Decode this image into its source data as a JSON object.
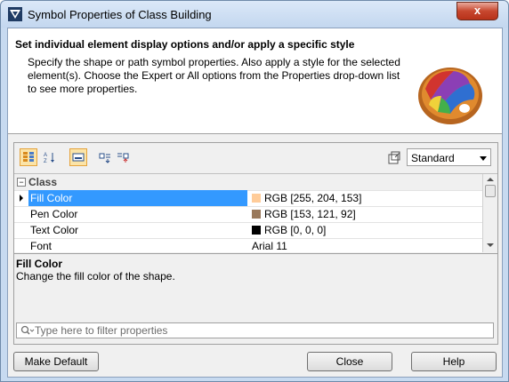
{
  "window": {
    "title": "Symbol Properties of Class Building",
    "close_label": "x"
  },
  "header": {
    "title": "Set individual element display options and/or apply a specific style",
    "description": "Specify the shape or path symbol properties. Also apply a style for the selected element(s). Choose the Expert or All options from the Properties drop-down list to see more properties."
  },
  "toolbar": {
    "icons": [
      "categorized-view-icon",
      "sort-alphabetical-icon",
      "show-description-icon",
      "expand-all-icon",
      "collapse-all-icon",
      "apply-style-icon"
    ],
    "mode_selected": "Standard"
  },
  "grid": {
    "group": {
      "label": "Class",
      "expander": "−"
    },
    "rows": [
      {
        "name": "Fill Color",
        "value": "RGB [255, 204, 153]",
        "swatch": "#ffcc99",
        "selected": true
      },
      {
        "name": "Pen Color",
        "value": "RGB [153, 121, 92]",
        "swatch": "#99795c",
        "selected": false
      },
      {
        "name": "Text Color",
        "value": "RGB [0, 0, 0]",
        "swatch": "#000000",
        "selected": false
      },
      {
        "name": "Font",
        "value": "Arial 11",
        "swatch": null,
        "selected": false
      }
    ]
  },
  "description": {
    "title": "Fill Color",
    "text": "Change the fill color of the shape."
  },
  "filter": {
    "placeholder": "Type here to filter properties",
    "value": ""
  },
  "buttons": {
    "make_default": "Make Default",
    "close": "Close",
    "help": "Help"
  },
  "colors": {
    "selection": "#3399ff",
    "title_gradient_top": "#dbe8f8",
    "close_button": "#c7472e"
  }
}
